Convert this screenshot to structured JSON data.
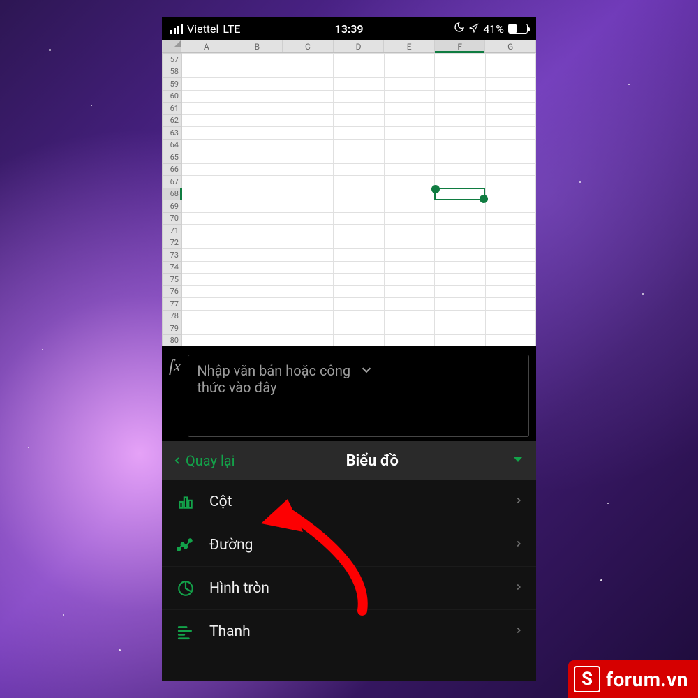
{
  "status": {
    "carrier": "Viettel",
    "network": "LTE",
    "time": "13:39",
    "battery_pct": "41%",
    "battery_fill_pct": 41
  },
  "sheet": {
    "cols": [
      "A",
      "B",
      "C",
      "D",
      "E",
      "F",
      "G"
    ],
    "row_start": 57,
    "row_end": 80,
    "selected_col": "F",
    "selected_row": 68
  },
  "fx": {
    "label": "fx",
    "placeholder": "Nhập văn bản hoặc công thức vào đây"
  },
  "panel": {
    "back": "Quay lại",
    "title": "Biểu đồ",
    "items": [
      {
        "icon": "bar-chart-icon",
        "label": "Cột"
      },
      {
        "icon": "line-chart-icon",
        "label": "Đường"
      },
      {
        "icon": "pie-chart-icon",
        "label": "Hình tròn"
      },
      {
        "icon": "horizontal-bar-icon",
        "label": "Thanh"
      }
    ]
  },
  "watermark": {
    "logo_letter": "S",
    "text": "forum.vn"
  }
}
